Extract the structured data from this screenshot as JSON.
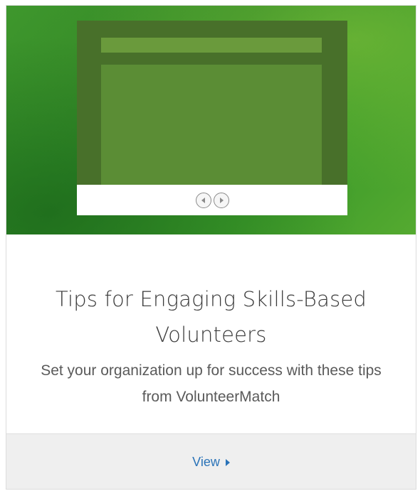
{
  "card": {
    "title": "Tips for Engaging Skills-Based Volunteers",
    "description": "Set your organization up for success with these tips from VolunteerMatch",
    "view_label": "View",
    "accent_color": "#2a73b8",
    "hero_color": "#3f9a2e"
  },
  "hero": {
    "prev_icon": "chevron-left-circle-icon",
    "next_icon": "chevron-right-circle-icon"
  }
}
